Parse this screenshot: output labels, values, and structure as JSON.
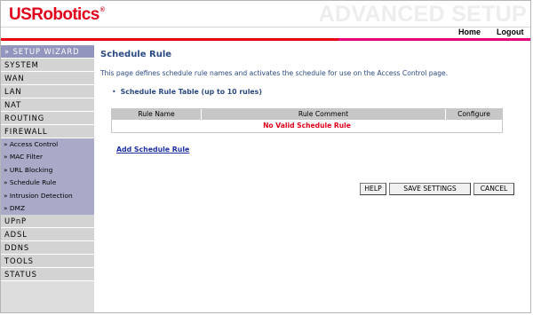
{
  "header": {
    "logo_text": "USRobotics",
    "logo_tm": "®",
    "banner": "ADVANCED SETUP",
    "nav": {
      "home": "Home",
      "logout": "Logout"
    }
  },
  "sidebar": {
    "wizard": "» SETUP WIZARD",
    "items_top": [
      "SYSTEM",
      "WAN",
      "LAN",
      "NAT",
      "ROUTING",
      "FIREWALL"
    ],
    "firewall_sub": [
      "» Access Control",
      "» MAC Filter",
      "» URL Blocking",
      "» Schedule Rule",
      "» Intrusion Detection",
      "» DMZ"
    ],
    "items_bottom": [
      "UPnP",
      "ADSL",
      "DDNS",
      "TOOLS",
      "STATUS"
    ]
  },
  "main": {
    "title": "Schedule Rule",
    "description": "This page defines schedule rule names and activates the schedule for use on the Access Control page.",
    "bullet": "•",
    "table_title": "Schedule Rule Table (up to 10 rules)",
    "table": {
      "headers": [
        "Rule Name",
        "Rule Comment",
        "Configure"
      ],
      "empty_message": "No Valid Schedule Rule"
    },
    "add_link": "Add Schedule Rule",
    "buttons": {
      "help": "HELP",
      "save": "SAVE SETTINGS",
      "cancel": "CANCEL"
    }
  },
  "colors": {
    "brand_red": "#e0001b",
    "accent_pink": "#e6007e",
    "title_blue": "#2b4a82",
    "link_blue": "#1d2fa3",
    "sidebar_gray": "#d3d3d3",
    "sidebar_sub": "#a9aac7",
    "wizard_bg": "#9295bd"
  }
}
